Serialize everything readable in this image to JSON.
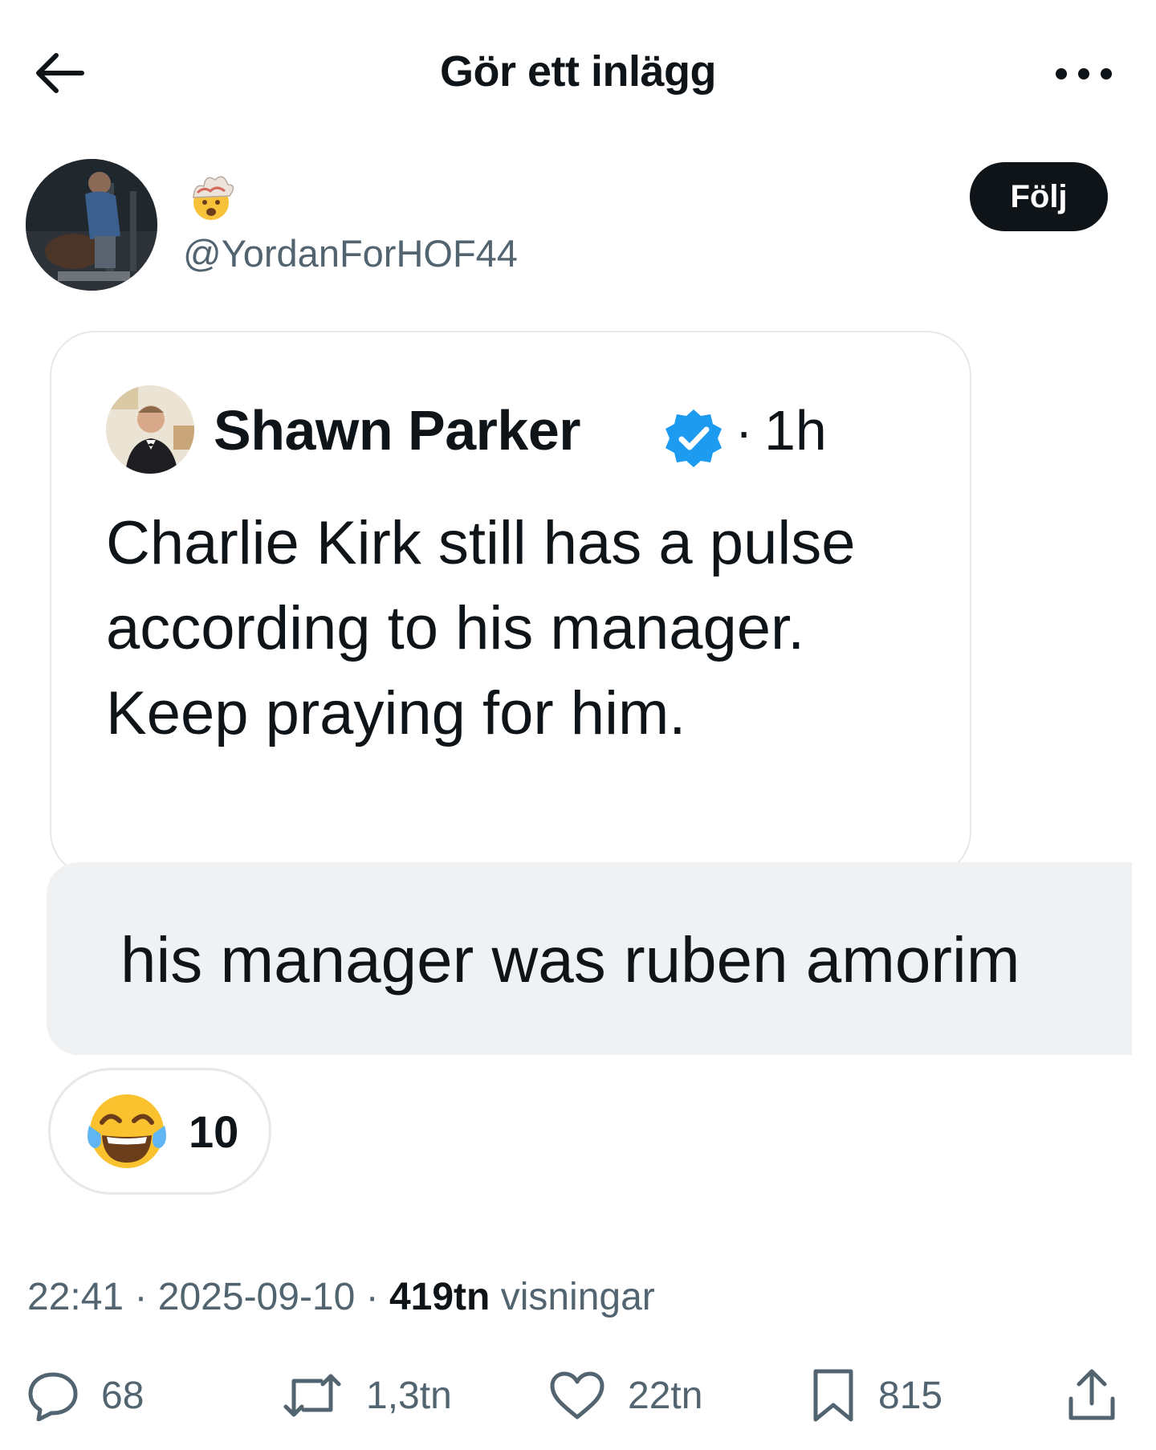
{
  "header": {
    "title": "Gör ett inlägg",
    "back_icon": "arrow-left-icon",
    "more_icon": "more-horizontal-icon"
  },
  "author": {
    "display_icon": "exploding-head-emoji-icon",
    "handle": "@YordanForHOF44",
    "follow_label": "Följ"
  },
  "quoted_post": {
    "name": "Shawn Parker",
    "verified": true,
    "separator": "·",
    "time": "1h",
    "text": "Charlie Kirk still has a pulse according to his manager. Keep praying for him."
  },
  "reply": {
    "text": "his manager was ruben amorim"
  },
  "reaction": {
    "emoji": "tears-of-joy-emoji-icon",
    "count": "10"
  },
  "meta": {
    "time": "22:41",
    "sep1": " · ",
    "date": "2025-09-10",
    "sep2": " · ",
    "views": "419tn",
    "views_label": " visningar"
  },
  "actions": {
    "replies": "68",
    "reposts": "1,3tn",
    "likes": "22tn",
    "bookmarks": "815"
  },
  "colors": {
    "text": "#0f1419",
    "secondary": "#536471",
    "verified": "#1d9bf0",
    "bubble": "#eff1f2",
    "border": "#e6e9ec"
  }
}
